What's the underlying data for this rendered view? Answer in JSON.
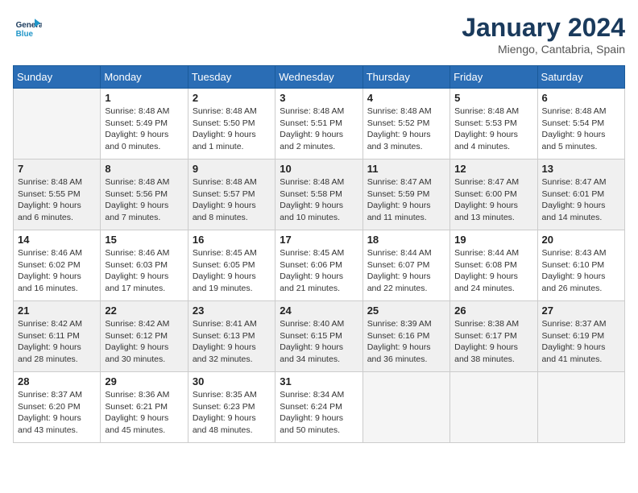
{
  "header": {
    "logo_line1": "General",
    "logo_line2": "Blue",
    "title": "January 2024",
    "location": "Miengo, Cantabria, Spain"
  },
  "days_of_week": [
    "Sunday",
    "Monday",
    "Tuesday",
    "Wednesday",
    "Thursday",
    "Friday",
    "Saturday"
  ],
  "weeks": [
    [
      {
        "day": "",
        "info": ""
      },
      {
        "day": "1",
        "info": "Sunrise: 8:48 AM\nSunset: 5:49 PM\nDaylight: 9 hours\nand 0 minutes."
      },
      {
        "day": "2",
        "info": "Sunrise: 8:48 AM\nSunset: 5:50 PM\nDaylight: 9 hours\nand 1 minute."
      },
      {
        "day": "3",
        "info": "Sunrise: 8:48 AM\nSunset: 5:51 PM\nDaylight: 9 hours\nand 2 minutes."
      },
      {
        "day": "4",
        "info": "Sunrise: 8:48 AM\nSunset: 5:52 PM\nDaylight: 9 hours\nand 3 minutes."
      },
      {
        "day": "5",
        "info": "Sunrise: 8:48 AM\nSunset: 5:53 PM\nDaylight: 9 hours\nand 4 minutes."
      },
      {
        "day": "6",
        "info": "Sunrise: 8:48 AM\nSunset: 5:54 PM\nDaylight: 9 hours\nand 5 minutes."
      }
    ],
    [
      {
        "day": "7",
        "info": "Sunrise: 8:48 AM\nSunset: 5:55 PM\nDaylight: 9 hours\nand 6 minutes."
      },
      {
        "day": "8",
        "info": "Sunrise: 8:48 AM\nSunset: 5:56 PM\nDaylight: 9 hours\nand 7 minutes."
      },
      {
        "day": "9",
        "info": "Sunrise: 8:48 AM\nSunset: 5:57 PM\nDaylight: 9 hours\nand 8 minutes."
      },
      {
        "day": "10",
        "info": "Sunrise: 8:48 AM\nSunset: 5:58 PM\nDaylight: 9 hours\nand 10 minutes."
      },
      {
        "day": "11",
        "info": "Sunrise: 8:47 AM\nSunset: 5:59 PM\nDaylight: 9 hours\nand 11 minutes."
      },
      {
        "day": "12",
        "info": "Sunrise: 8:47 AM\nSunset: 6:00 PM\nDaylight: 9 hours\nand 13 minutes."
      },
      {
        "day": "13",
        "info": "Sunrise: 8:47 AM\nSunset: 6:01 PM\nDaylight: 9 hours\nand 14 minutes."
      }
    ],
    [
      {
        "day": "14",
        "info": "Sunrise: 8:46 AM\nSunset: 6:02 PM\nDaylight: 9 hours\nand 16 minutes."
      },
      {
        "day": "15",
        "info": "Sunrise: 8:46 AM\nSunset: 6:03 PM\nDaylight: 9 hours\nand 17 minutes."
      },
      {
        "day": "16",
        "info": "Sunrise: 8:45 AM\nSunset: 6:05 PM\nDaylight: 9 hours\nand 19 minutes."
      },
      {
        "day": "17",
        "info": "Sunrise: 8:45 AM\nSunset: 6:06 PM\nDaylight: 9 hours\nand 21 minutes."
      },
      {
        "day": "18",
        "info": "Sunrise: 8:44 AM\nSunset: 6:07 PM\nDaylight: 9 hours\nand 22 minutes."
      },
      {
        "day": "19",
        "info": "Sunrise: 8:44 AM\nSunset: 6:08 PM\nDaylight: 9 hours\nand 24 minutes."
      },
      {
        "day": "20",
        "info": "Sunrise: 8:43 AM\nSunset: 6:10 PM\nDaylight: 9 hours\nand 26 minutes."
      }
    ],
    [
      {
        "day": "21",
        "info": "Sunrise: 8:42 AM\nSunset: 6:11 PM\nDaylight: 9 hours\nand 28 minutes."
      },
      {
        "day": "22",
        "info": "Sunrise: 8:42 AM\nSunset: 6:12 PM\nDaylight: 9 hours\nand 30 minutes."
      },
      {
        "day": "23",
        "info": "Sunrise: 8:41 AM\nSunset: 6:13 PM\nDaylight: 9 hours\nand 32 minutes."
      },
      {
        "day": "24",
        "info": "Sunrise: 8:40 AM\nSunset: 6:15 PM\nDaylight: 9 hours\nand 34 minutes."
      },
      {
        "day": "25",
        "info": "Sunrise: 8:39 AM\nSunset: 6:16 PM\nDaylight: 9 hours\nand 36 minutes."
      },
      {
        "day": "26",
        "info": "Sunrise: 8:38 AM\nSunset: 6:17 PM\nDaylight: 9 hours\nand 38 minutes."
      },
      {
        "day": "27",
        "info": "Sunrise: 8:37 AM\nSunset: 6:19 PM\nDaylight: 9 hours\nand 41 minutes."
      }
    ],
    [
      {
        "day": "28",
        "info": "Sunrise: 8:37 AM\nSunset: 6:20 PM\nDaylight: 9 hours\nand 43 minutes."
      },
      {
        "day": "29",
        "info": "Sunrise: 8:36 AM\nSunset: 6:21 PM\nDaylight: 9 hours\nand 45 minutes."
      },
      {
        "day": "30",
        "info": "Sunrise: 8:35 AM\nSunset: 6:23 PM\nDaylight: 9 hours\nand 48 minutes."
      },
      {
        "day": "31",
        "info": "Sunrise: 8:34 AM\nSunset: 6:24 PM\nDaylight: 9 hours\nand 50 minutes."
      },
      {
        "day": "",
        "info": ""
      },
      {
        "day": "",
        "info": ""
      },
      {
        "day": "",
        "info": ""
      }
    ]
  ]
}
